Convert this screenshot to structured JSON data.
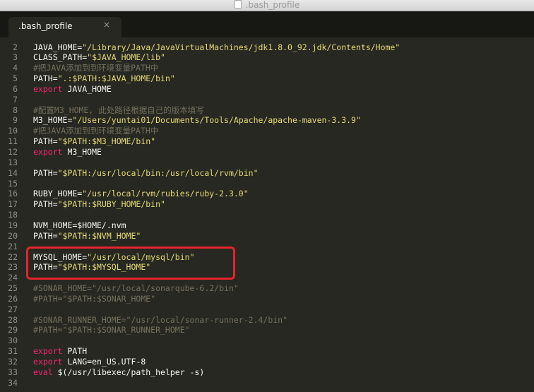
{
  "window": {
    "title": ".bash_profile"
  },
  "tab": {
    "label": ".bash_profile",
    "close": "×"
  },
  "lines": [
    {
      "n": "2",
      "segs": [
        {
          "t": "JAVA_HOME="
        },
        {
          "t": "\"/Library/Java/JavaVirtualMachines/jdk1.8.0_92.jdk/Contents/Home\"",
          "c": "s"
        }
      ]
    },
    {
      "n": "3",
      "segs": [
        {
          "t": "CLASS_PATH="
        },
        {
          "t": "\"$JAVA_HOME/lib\"",
          "c": "s"
        }
      ]
    },
    {
      "n": "4",
      "segs": [
        {
          "t": "#把JAVA添加到到环境变量PATH中",
          "c": "c"
        }
      ]
    },
    {
      "n": "5",
      "segs": [
        {
          "t": "PATH="
        },
        {
          "t": "\".:$PATH:$JAVA_HOME/bin\"",
          "c": "s"
        }
      ]
    },
    {
      "n": "6",
      "segs": [
        {
          "t": "export",
          "c": "k"
        },
        {
          "t": " JAVA_HOME"
        }
      ]
    },
    {
      "n": "7",
      "segs": []
    },
    {
      "n": "8",
      "segs": [
        {
          "t": "#配置M3_HOME, 此处路径根据自己的版本填写",
          "c": "c"
        }
      ]
    },
    {
      "n": "9",
      "segs": [
        {
          "t": "M3_HOME="
        },
        {
          "t": "\"/Users/yuntai01/Documents/Tools/Apache/apache-maven-3.3.9\"",
          "c": "s"
        }
      ]
    },
    {
      "n": "10",
      "segs": [
        {
          "t": "#把JAVA添加到到环境变量PATH中",
          "c": "c"
        }
      ]
    },
    {
      "n": "11",
      "segs": [
        {
          "t": "PATH="
        },
        {
          "t": "\"$PATH:$M3_HOME/bin\"",
          "c": "s"
        }
      ]
    },
    {
      "n": "12",
      "segs": [
        {
          "t": "export",
          "c": "k"
        },
        {
          "t": " M3_HOME"
        }
      ]
    },
    {
      "n": "13",
      "segs": []
    },
    {
      "n": "14",
      "segs": [
        {
          "t": "PATH="
        },
        {
          "t": "\"$PATH:/usr/local/bin:/usr/local/rvm/bin\"",
          "c": "s"
        }
      ]
    },
    {
      "n": "15",
      "segs": []
    },
    {
      "n": "16",
      "segs": [
        {
          "t": "RUBY_HOME="
        },
        {
          "t": "\"/usr/local/rvm/rubies/ruby-2.3.0\"",
          "c": "s"
        }
      ]
    },
    {
      "n": "17",
      "segs": [
        {
          "t": "PATH="
        },
        {
          "t": "\"$PATH:$RUBY_HOME/bin\"",
          "c": "s"
        }
      ]
    },
    {
      "n": "18",
      "segs": []
    },
    {
      "n": "19",
      "segs": [
        {
          "t": "NVM_HOME=$HOME/.nvm"
        }
      ]
    },
    {
      "n": "20",
      "segs": [
        {
          "t": "PATH="
        },
        {
          "t": "\"$PATH:$NVM_HOME\"",
          "c": "s"
        }
      ]
    },
    {
      "n": "21",
      "segs": []
    },
    {
      "n": "22",
      "segs": [
        {
          "t": "MYSQL_HOME="
        },
        {
          "t": "\"/usr/local/mysql/bin\"",
          "c": "s"
        }
      ]
    },
    {
      "n": "23",
      "segs": [
        {
          "t": "PATH="
        },
        {
          "t": "\"$PATH:$MYSQL_HOME\"",
          "c": "s"
        }
      ]
    },
    {
      "n": "24",
      "segs": []
    },
    {
      "n": "25",
      "segs": [
        {
          "t": "#SONAR_HOME=\"/usr/local/sonarqube-6.2/bin\"",
          "c": "c"
        }
      ]
    },
    {
      "n": "26",
      "segs": [
        {
          "t": "#PATH=\"$PATH:$SONAR_HOME\"",
          "c": "c"
        }
      ]
    },
    {
      "n": "27",
      "segs": []
    },
    {
      "n": "28",
      "segs": [
        {
          "t": "#SONAR_RUNNER_HOME=\"/usr/local/sonar-runner-2.4/bin\"",
          "c": "c"
        }
      ]
    },
    {
      "n": "29",
      "segs": [
        {
          "t": "#PATH=\"$PATH:$SONAR_RUNNER_HOME\"",
          "c": "c"
        }
      ]
    },
    {
      "n": "30",
      "segs": []
    },
    {
      "n": "31",
      "segs": [
        {
          "t": "export",
          "c": "k"
        },
        {
          "t": " PATH"
        }
      ]
    },
    {
      "n": "32",
      "segs": [
        {
          "t": "export",
          "c": "k"
        },
        {
          "t": " LANG=en_US.UTF-8"
        }
      ]
    },
    {
      "n": "33",
      "segs": [
        {
          "t": "eval",
          "c": "k"
        },
        {
          "t": " $(/usr/libexec/path_helper -s)"
        }
      ]
    },
    {
      "n": "34",
      "segs": []
    }
  ]
}
